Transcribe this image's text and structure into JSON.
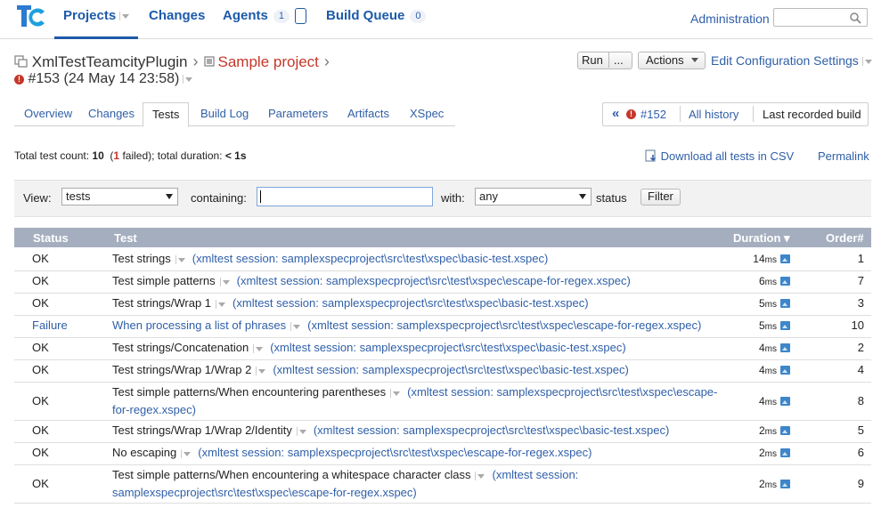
{
  "nav": {
    "tabs": [
      {
        "label": "Projects",
        "active": true
      },
      {
        "label": "Changes"
      },
      {
        "label": "Agents",
        "badge": "1"
      },
      {
        "label": "Build Queue",
        "badge": "0"
      }
    ],
    "admin_label": "Administration",
    "search_placeholder": ""
  },
  "breadcrumb": {
    "root": "XmlTestTeamcityPlugin",
    "project": "Sample project",
    "build": "#153 (24 May 14 23:58)"
  },
  "actions": {
    "run": "Run",
    "run_more": "...",
    "actions": "Actions",
    "edit": "Edit Configuration Settings"
  },
  "tabs": [
    "Overview",
    "Changes",
    "Tests",
    "Build Log",
    "Parameters",
    "Artifacts",
    "XSpec"
  ],
  "active_tab": "Tests",
  "history": {
    "prev": "#152",
    "all": "All history",
    "last": "Last recorded build"
  },
  "summary": {
    "prefix": "Total test count: ",
    "count": "10",
    "mid1": "  (",
    "failed": "1",
    "mid2": " failed); total duration: ",
    "duration": "< 1s"
  },
  "csv_label": "Download all tests in CSV",
  "permalink_label": "Permalink",
  "filter": {
    "view_label": "View:",
    "view_value": "tests",
    "containing_label": "containing:",
    "containing_value": "",
    "with_label": "with:",
    "with_value": "any",
    "status_label": "status",
    "button": "Filter"
  },
  "table": {
    "headers": {
      "status": "Status",
      "test": "Test",
      "duration": "Duration ▾",
      "order": "Order#"
    },
    "rows": [
      {
        "status": "OK",
        "name": "Test strings",
        "session": "(xmltest session: samplexspecproject\\src\\test\\xspec\\basic-test.xspec)",
        "dur": "14",
        "ord": "1"
      },
      {
        "status": "OK",
        "name": "Test simple patterns",
        "session": "(xmltest session: samplexspecproject\\src\\test\\xspec\\escape-for-regex.xspec)",
        "dur": "6",
        "ord": "7"
      },
      {
        "status": "OK",
        "name": "Test strings/Wrap 1",
        "session": "(xmltest session: samplexspecproject\\src\\test\\xspec\\basic-test.xspec)",
        "dur": "5",
        "ord": "3"
      },
      {
        "status": "Failure",
        "name": "When processing a list of phrases",
        "session": "(xmltest session: samplexspecproject\\src\\test\\xspec\\escape-for-regex.xspec)",
        "dur": "5",
        "ord": "10"
      },
      {
        "status": "OK",
        "name": "Test strings/Concatenation",
        "session": "(xmltest session: samplexspecproject\\src\\test\\xspec\\basic-test.xspec)",
        "dur": "4",
        "ord": "2"
      },
      {
        "status": "OK",
        "name": "Test strings/Wrap 1/Wrap 2",
        "session": "(xmltest session: samplexspecproject\\src\\test\\xspec\\basic-test.xspec)",
        "dur": "4",
        "ord": "4"
      },
      {
        "status": "OK",
        "name": "Test simple patterns/When encountering parentheses",
        "session": "(xmltest session: samplexspecproject\\src\\test\\xspec\\escape-for-regex.xspec)",
        "dur": "4",
        "ord": "8"
      },
      {
        "status": "OK",
        "name": "Test strings/Wrap 1/Wrap 2/Identity",
        "session": "(xmltest session: samplexspecproject\\src\\test\\xspec\\basic-test.xspec)",
        "dur": "2",
        "ord": "5"
      },
      {
        "status": "OK",
        "name": "No escaping",
        "session": "(xmltest session: samplexspecproject\\src\\test\\xspec\\escape-for-regex.xspec)",
        "dur": "2",
        "ord": "6"
      },
      {
        "status": "OK",
        "name": "Test simple patterns/When encountering a whitespace character class",
        "session": "(xmltest session: samplexspecproject\\src\\test\\xspec\\escape-for-regex.xspec)",
        "dur": "2",
        "ord": "9"
      }
    ],
    "unit": "ms"
  },
  "colors": {
    "link": "#2f5fa8",
    "failure": "#c6372a",
    "header_bg": "#a5aebf"
  }
}
